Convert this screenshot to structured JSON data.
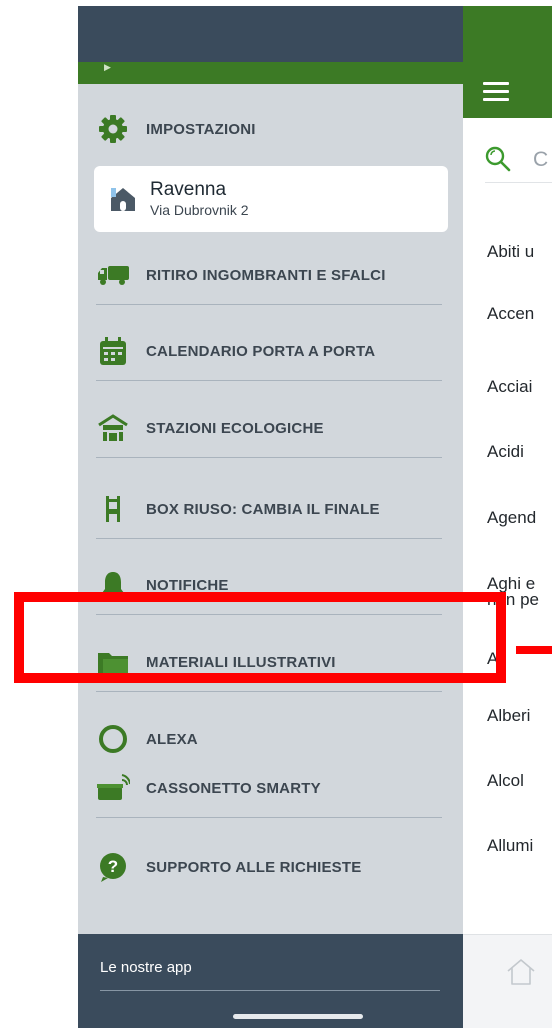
{
  "drawer": {
    "items": [
      {
        "label": "IMPOSTAZIONI",
        "icon": "gear-icon"
      },
      {
        "label": "RITIRO INGOMBRANTI E SFALCI",
        "icon": "truck-icon"
      },
      {
        "label": "CALENDARIO PORTA A PORTA",
        "icon": "calendar-icon"
      },
      {
        "label": "STAZIONI ECOLOGICHE",
        "icon": "eco-station-icon"
      },
      {
        "label": "BOX RIUSO: CAMBIA IL FINALE",
        "icon": "chair-icon"
      },
      {
        "label": "NOTIFICHE",
        "icon": "bell-icon"
      },
      {
        "label": "MATERIALI ILLUSTRATIVI",
        "icon": "folder-icon"
      },
      {
        "label": "ALEXA",
        "icon": "alexa-icon"
      },
      {
        "label": "CASSONETTO SMARTY",
        "icon": "smart-bin-icon"
      },
      {
        "label": "SUPPORTO ALLE RICHIESTE",
        "icon": "help-icon"
      }
    ],
    "city": {
      "name": "Ravenna",
      "street": "Via Dubrovnik 2",
      "icon": "house-icon"
    },
    "footer": {
      "apps_label": "Le nostre app"
    }
  },
  "main": {
    "search_placeholder": "C",
    "rows": [
      "Abiti u",
      "Accen",
      "Acciai",
      "Acidi",
      "Agend",
      "Aghi e",
      "non pe",
      "Al",
      "Alberi",
      "Alcol",
      "Allumi"
    ]
  },
  "colors": {
    "green": "#3c7a25",
    "navy": "#3a4b5c",
    "drawer_bg": "#d2d7dc",
    "highlight": "#ff0000"
  }
}
